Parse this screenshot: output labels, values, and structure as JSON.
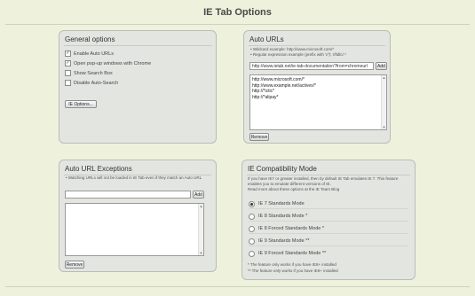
{
  "page": {
    "title": "IE Tab Options"
  },
  "general": {
    "title": "General options",
    "checkboxes": [
      {
        "label": "Enable Auto URLs",
        "checked": true
      },
      {
        "label": "Open pop-up windows with Chrome",
        "checked": true
      },
      {
        "label": "Show Search Box",
        "checked": false
      },
      {
        "label": "Disable Auto-Search",
        "checked": false
      }
    ],
    "ie_options_button": "IE Options..."
  },
  "auto_urls": {
    "title": "Auto URLs",
    "notes": [
      "• Wildcard example: http://www.microsoft.com/*",
      "• Regular expression example (prefix with 'r/'): r/ftdlc/.*"
    ],
    "input_value": "http://www.ietab.net/ie-tab-documentation?from=chromeurl",
    "add_button": "Add",
    "list": [
      "http://www.microsoft.com/*",
      "http://www.example.net/activex/*",
      "http://*ictic*",
      "http://*alipay*"
    ],
    "remove_button": "Remove"
  },
  "exceptions": {
    "title": "Auto URL Exceptions",
    "note": "• Watching URLs will not be loaded in IE Tab even if they match an Auto URL",
    "input_value": "",
    "add_button": "Add",
    "list": [],
    "remove_button": "Remove"
  },
  "compat": {
    "title": "IE Compatibility Mode",
    "description": "If you have IE7 or greater installed, then by default IE Tab emulates IE 7. This feature enables you to emulate different versions of IE.",
    "link_text": "Read more about these options at the IE Team Blog",
    "options": [
      {
        "label": "IE 7 Standards Mode",
        "selected": true
      },
      {
        "label": "IE 8 Standards Mode *",
        "selected": false
      },
      {
        "label": "IE 8 Forced Standards Mode *",
        "selected": false
      },
      {
        "label": "IE 9 Standards Mode **",
        "selected": false
      },
      {
        "label": "IE 9 Forced Standards Mode **",
        "selected": false
      }
    ],
    "footnotes": [
      "*  The feature only works if you have IE8+ installed",
      "** The feature only works if you have IE9+ installed"
    ]
  }
}
